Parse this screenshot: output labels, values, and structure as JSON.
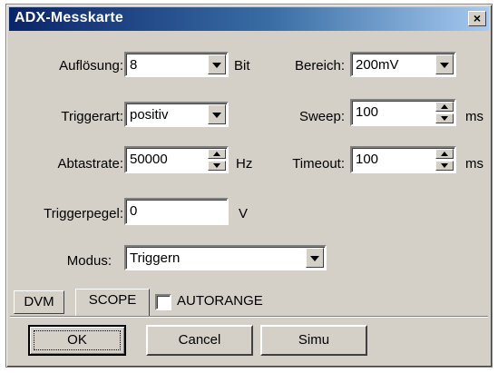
{
  "window": {
    "title": "ADX-Messkarte",
    "close_glyph": "×"
  },
  "fields": {
    "aufloesung": {
      "label": "Auflösung:",
      "value": "8",
      "unit": "Bit"
    },
    "bereich": {
      "label": "Bereich:",
      "value": "200mV"
    },
    "triggerart": {
      "label": "Triggerart:",
      "value": "positiv"
    },
    "sweep": {
      "label": "Sweep:",
      "value": "100",
      "unit": "ms"
    },
    "abtastrate": {
      "label": "Abtastrate:",
      "value": "50000",
      "unit": "Hz"
    },
    "timeout": {
      "label": "Timeout:",
      "value": "100",
      "unit": "ms"
    },
    "triggerpegel": {
      "label": "Triggerpegel:",
      "value": "0",
      "unit": "V"
    },
    "modus": {
      "label": "Modus:",
      "value": "Triggern"
    }
  },
  "tabs": [
    {
      "label": "DVM",
      "active": false
    },
    {
      "label": "SCOPE",
      "active": true
    }
  ],
  "autorange": {
    "label": "AUTORANGE",
    "checked": false
  },
  "buttons": {
    "ok": "OK",
    "cancel": "Cancel",
    "simu": "Simu"
  },
  "icons": {
    "dropdown": "chevron-down-icon",
    "spinner": "spinner-icon",
    "close": "close-icon"
  }
}
